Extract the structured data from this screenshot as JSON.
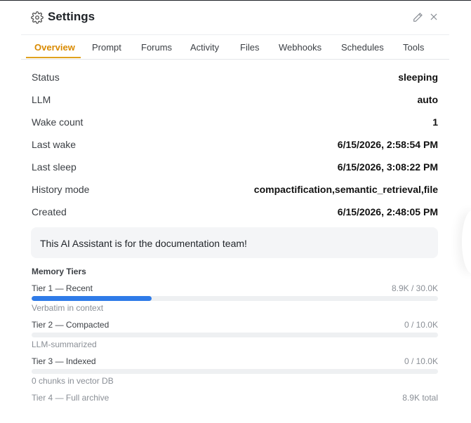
{
  "header": {
    "title": "Settings"
  },
  "tabs": [
    {
      "label": "Overview"
    },
    {
      "label": "Prompt"
    },
    {
      "label": "Forums"
    },
    {
      "label": "Activity"
    },
    {
      "label": "Files"
    },
    {
      "label": "Webhooks"
    },
    {
      "label": "Schedules"
    },
    {
      "label": "Tools"
    }
  ],
  "active_tab": "Overview",
  "overview": {
    "rows": [
      {
        "label": "Status",
        "value": "sleeping"
      },
      {
        "label": "LLM",
        "value": "auto"
      },
      {
        "label": "Wake count",
        "value": "1"
      },
      {
        "label": "Last wake",
        "value": "6/15/2026, 2:58:54 PM"
      },
      {
        "label": "Last sleep",
        "value": "6/15/2026, 3:08:22 PM"
      },
      {
        "label": "History mode",
        "value": "compactification,semantic_retrieval,file"
      },
      {
        "label": "Created",
        "value": "6/15/2026, 2:48:05 PM"
      }
    ],
    "description": "This AI Assistant is for the documentation team!"
  },
  "memory": {
    "title": "Memory Tiers",
    "tiers": [
      {
        "label": "Tier 1 — Recent",
        "count": "8.9K / 30.0K",
        "fill": 0.296,
        "desc": "Verbatim in context"
      },
      {
        "label": "Tier 2 — Compacted",
        "count": "0 / 10.0K",
        "fill": 0,
        "desc": "LLM-summarized"
      },
      {
        "label": "Tier 3 — Indexed",
        "count": "0 / 10.0K",
        "fill": 0,
        "desc": "0 chunks in vector DB"
      },
      {
        "label": "Tier 4 — Full archive",
        "count": "8.9K total"
      }
    ]
  },
  "colors": {
    "accent": "#d98a00",
    "progress": "#2f7be8"
  },
  "icons": {
    "header": "gear-icon",
    "edit": "pencil-icon",
    "close": "close-icon"
  }
}
